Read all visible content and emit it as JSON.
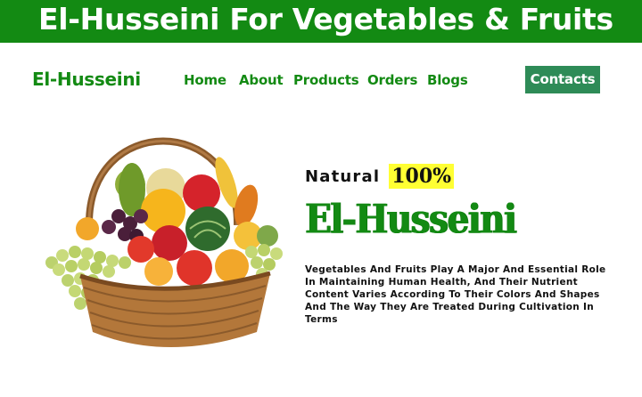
{
  "banner": {
    "title": "El-Husseini For Vegetables & Fruits"
  },
  "nav": {
    "brand": "El-Husseini",
    "links": [
      "Home",
      "About",
      "Products",
      "Orders",
      "Blogs"
    ],
    "contact_label": "Contacts"
  },
  "hero": {
    "tag_natural": "Natural",
    "tag_percent": "100%",
    "title": "El-Husseini",
    "description": "Vegetables And Fruits Play A Major And Essential Role In Maintaining Human Health, And Their Nutrient Content Varies According To Their Colors And Shapes And The Way They Are Treated During Cultivation In Terms",
    "image_icon": "fruit-basket-icon"
  },
  "colors": {
    "brand_green": "#138a13",
    "contact_button": "#2e8b57",
    "highlight_yellow": "#ffff33"
  }
}
